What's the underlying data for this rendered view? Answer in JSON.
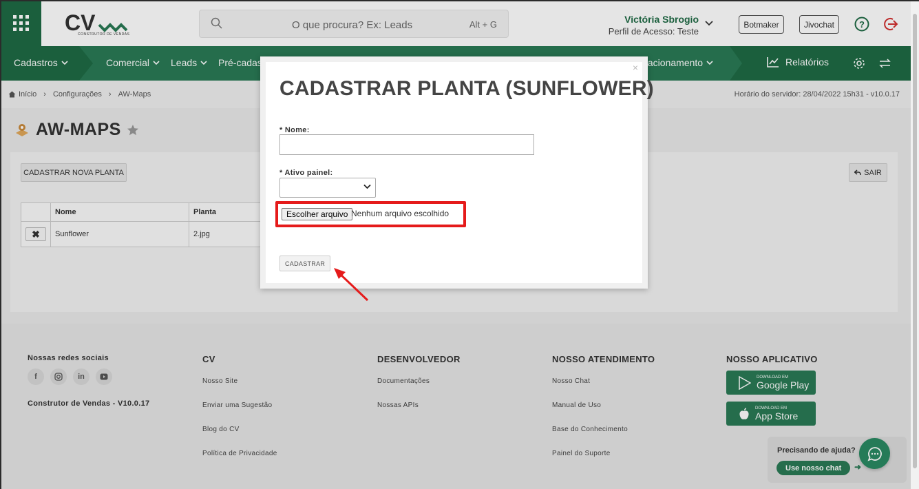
{
  "header": {
    "logo_tagline": "CONSTRUTOR DE VENDAS",
    "search_placeholder": "O que procura? Ex: Leads",
    "search_shortcut": "Alt + G",
    "user_name": "Victória Sbrogio",
    "user_profile": "Perfil de Acesso: Teste",
    "botmaker_label": "Botmaker",
    "jivochat_label": "Jivochat"
  },
  "nav": {
    "items": [
      "Cadastros",
      "Comercial",
      "Leads",
      "Pré-cadastr",
      "elacionamento"
    ],
    "reports_label": "Relatórios"
  },
  "breadcrumb": {
    "items": [
      "Início",
      "Configurações",
      "AW-Maps"
    ],
    "server_time": "Horário do servidor: 28/04/2022 15h31 - v10.0.17"
  },
  "page": {
    "title": "AW-MAPS",
    "new_plant_button": "CADASTRAR NOVA PLANTA",
    "exit_button": "SAIR",
    "table": {
      "headers": [
        "Nome",
        "Planta"
      ],
      "rows": [
        {
          "name": "Sunflower",
          "plant": "2.jpg"
        }
      ]
    }
  },
  "modal": {
    "close": "×",
    "title": "CADASTRAR PLANTA (SUNFLOWER)",
    "name_label": "* Nome:",
    "active_label": "* Ativo painel:",
    "file_button": "Escolher arquivo",
    "file_status": "Nenhum arquivo escolhido",
    "submit_button": "CADASTRAR"
  },
  "footer": {
    "social_title": "Nossas redes sociais",
    "social_icons": [
      "facebook-icon",
      "instagram-icon",
      "linkedin-icon",
      "youtube-icon"
    ],
    "version": "Construtor de Vendas - V10.0.17",
    "cv": {
      "title": "CV",
      "links": [
        "Nosso Site",
        "Enviar uma Sugestão",
        "Blog do CV",
        "Política de Privacidade"
      ]
    },
    "dev": {
      "title": "DESENVOLVEDOR",
      "links": [
        "Documentações",
        "Nossas APIs"
      ]
    },
    "support": {
      "title": "NOSSO ATENDIMENTO",
      "links": [
        "Nosso Chat",
        "Manual de Uso",
        "Base do Conhecimento",
        "Painel do Suporte"
      ]
    },
    "app": {
      "title": "NOSSO APLICATIVO",
      "google_small": "DOWNLOAD EM",
      "google_big": "Google Play",
      "apple_small": "DOWNLOAD EM",
      "apple_big": "App Store"
    },
    "help_question": "Precisando de ajuda?",
    "help_button": "Use nosso chat"
  },
  "colors": {
    "brand": "#2a7a55",
    "brand_dark": "#1f6a45",
    "highlight": "#e51b1b"
  }
}
